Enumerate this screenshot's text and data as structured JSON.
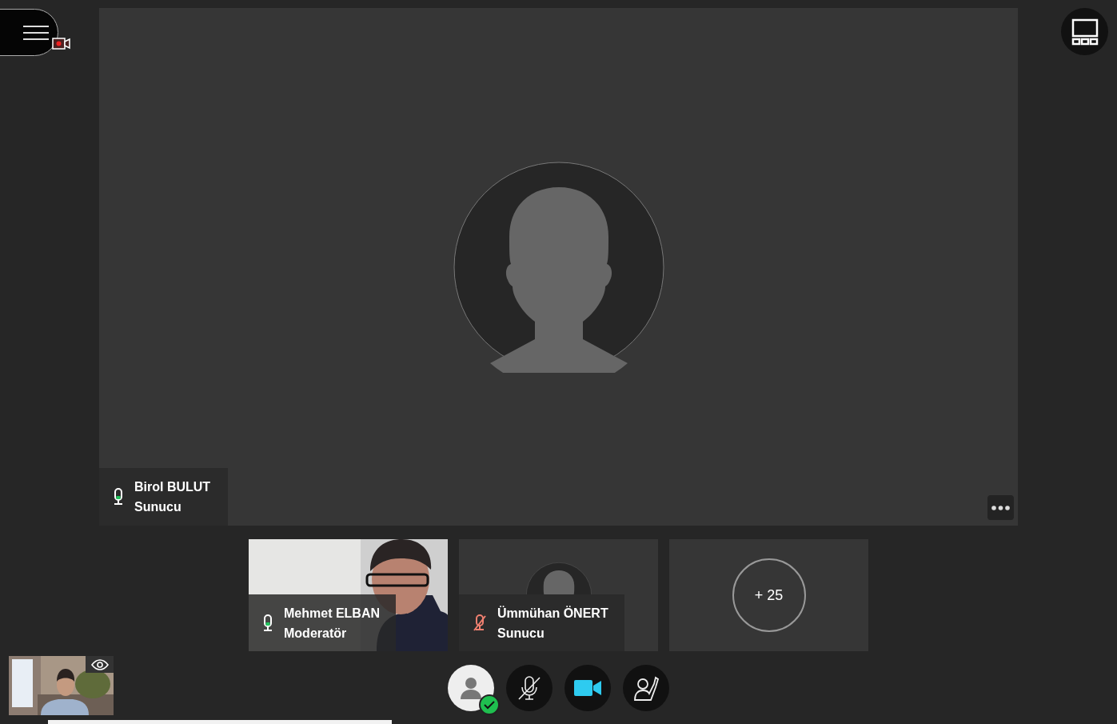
{
  "main_speaker": {
    "name": "Birol BULUT",
    "role": "Sunucu",
    "muted": false
  },
  "tiles": [
    {
      "kind": "video",
      "name": "Mehmet ELBAN",
      "role": "Moderatör",
      "muted": false
    },
    {
      "kind": "avatar",
      "name": "Ümmühan ÖNERT",
      "role": "Sunucu",
      "muted": true
    },
    {
      "kind": "more",
      "count": "+ 25"
    }
  ],
  "controls": {
    "status_ok": true,
    "mic_muted": true,
    "camera_on": true
  },
  "recording": true
}
